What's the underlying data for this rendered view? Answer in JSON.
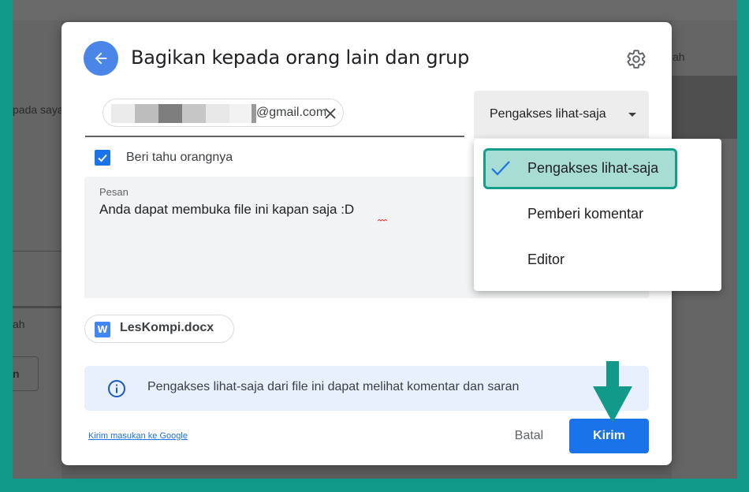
{
  "background": {
    "left_text_1": "pada saya",
    "left_text_2": "ah",
    "left_button": "n",
    "right_text": "ah"
  },
  "dialog": {
    "title": "Bagikan kepada orang lain dan grup",
    "back_icon": "arrow-left-icon",
    "settings_icon": "gear-icon",
    "recipient": {
      "email_visible": "@gmail.com"
    },
    "role_select": {
      "value": "Pengakses lihat-saja"
    },
    "notify": {
      "checked": true,
      "label": "Beri tahu orangnya"
    },
    "message": {
      "label": "Pesan",
      "text": "Anda dapat membuka file ini kapan saja :D"
    },
    "attachment": {
      "icon_letter": "W",
      "name": "LesKompi.docx"
    },
    "info": {
      "text": "Pengakses lihat-saja dari file ini dapat melihat komentar dan saran"
    },
    "footer": {
      "feedback_link": "Kirim masukan ke Google",
      "cancel_label": "Batal",
      "send_label": "Kirim"
    }
  },
  "dropdown": {
    "options": [
      {
        "label": "Pengakses lihat-saja",
        "selected": true
      },
      {
        "label": "Pemberi komentar",
        "selected": false
      },
      {
        "label": "Editor",
        "selected": false
      }
    ]
  },
  "colors": {
    "frame": "#119a8a",
    "primary": "#1a73e8",
    "highlight_fill": "#a7ddd3",
    "highlight_border": "#139e8c"
  }
}
